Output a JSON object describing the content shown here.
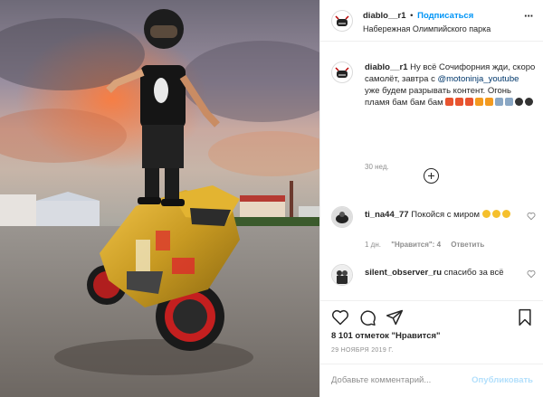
{
  "post": {
    "photo_alt": "photo",
    "author": {
      "username": "diablo__r1",
      "follow_label": "Подписаться",
      "separator": "•",
      "location": "Набережная Олимпийского парка"
    },
    "caption": {
      "username": "diablo__r1",
      "text_before": "Ну всё Сочифорния жди, скоро самолёт, завтра с",
      "mention": "@motoninja_youtube",
      "text_after": "уже будем разрывать контент. Огонь пламя бам бам бам",
      "emojis": [
        "collision",
        "collision",
        "collision",
        "fire",
        "fire",
        "rocket",
        "rocket",
        "bomb",
        "bomb"
      ],
      "age": "30 нед."
    },
    "comments": [
      {
        "username": "ti_na44_77",
        "text": "Покойся с миром",
        "emojis": [
          "sad-face",
          "sad-face",
          "sad-face"
        ],
        "time": "1 дн.",
        "likes": "\"Нравится\": 4",
        "reply": "Ответить"
      },
      {
        "username": "silent_observer_ru",
        "text": "спасибо за всё"
      }
    ],
    "likes_text": "8 101 отметок \"Нравится\"",
    "date": "29 НОЯБРЯ 2019 Г.",
    "comment_placeholder": "Добавьте комментарий...",
    "publish_label": "Опубликовать",
    "icons": [
      "heart-icon",
      "comment-icon",
      "share-icon",
      "bookmark-icon",
      "more-options-icon",
      "add-circle-icon"
    ],
    "colors": {
      "link": "#0095f6",
      "mention": "#00376b",
      "muted": "#8e8e8e",
      "publish_disabled": "#b2dffc"
    }
  }
}
